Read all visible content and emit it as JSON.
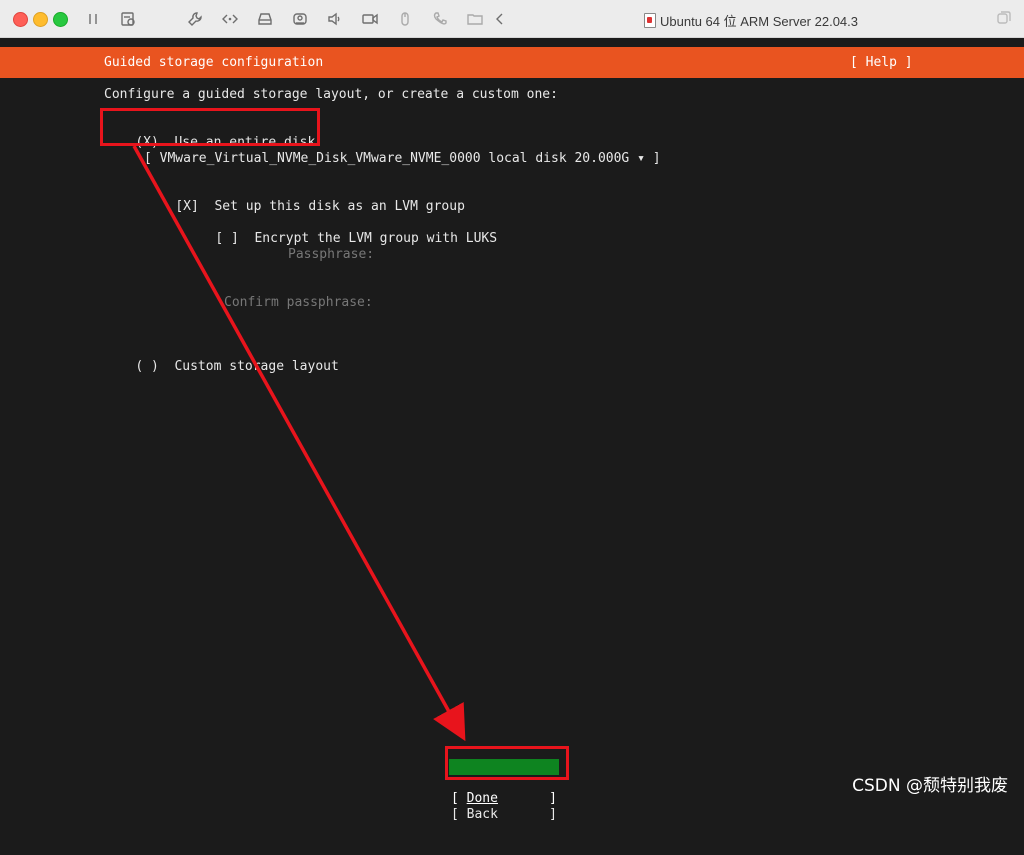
{
  "window": {
    "title": "Ubuntu 64 位 ARM Server 22.04.3"
  },
  "toolbar_icons": [
    "pause-icon",
    "snapshot-icon",
    "wrench-icon",
    "network-icon",
    "hard-disk-icon",
    "camera-usb-icon",
    "sound-icon",
    "video-icon",
    "usb-mouse-icon",
    "phone-icon",
    "folder-share-icon",
    "back-chevron-icon",
    "fullscreen-icon"
  ],
  "installer": {
    "header_title": "Guided storage configuration",
    "help_label": "[ Help ]",
    "intro": "Configure a guided storage layout, or create a custom one:",
    "option_entire_disk": {
      "marker": "(X)",
      "label": "Use an entire disk"
    },
    "disk_select": "[ VMware_Virtual_NVMe_Disk_VMware_NVME_0000 local disk 20.000G ▾ ]",
    "lvm_checkbox": {
      "marker": "[X]",
      "label": "Set up this disk as an LVM group"
    },
    "luks_checkbox": {
      "marker": "[ ]",
      "label": "Encrypt the LVM group with LUKS"
    },
    "passphrase_label": "Passphrase:",
    "confirm_passphrase_label": "Confirm passphrase:",
    "option_custom": {
      "marker": "( )",
      "label": "Custom storage layout"
    },
    "done_button": {
      "open": "[",
      "label": "Done",
      "close": "]"
    },
    "back_button": {
      "open": "[",
      "label": "Back",
      "close": "]"
    }
  },
  "colors": {
    "header_bg": "#e95420",
    "done_bg": "#0e8420",
    "terminal_bg": "#1b1b1b",
    "annotation": "#e8141c"
  },
  "watermark": "CSDN @颓特别我废"
}
